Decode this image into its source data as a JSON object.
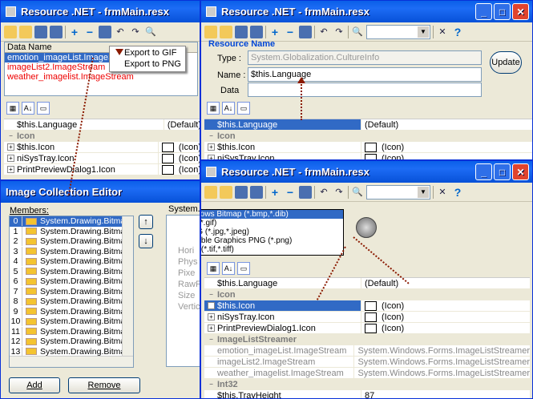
{
  "win1": {
    "title": "Resource .NET - frmMain.resx",
    "header": "Data Name",
    "items": [
      "emotion_imageList.ImageStream",
      "imageList2.ImageStream",
      "weather_imagelist.ImageStream"
    ],
    "menu": [
      "Export to GIF",
      "Export to PNG"
    ],
    "props": [
      {
        "n": "$this.Language",
        "v": "(Default)"
      },
      {
        "n": "Icon",
        "cat": true
      },
      {
        "n": "$this.Icon",
        "v": "(Icon)",
        "plus": true
      },
      {
        "n": "niSysTray.Icon",
        "v": "(Icon)",
        "plus": true
      },
      {
        "n": "PrintPreviewDialog1.Icon",
        "v": "(Icon)",
        "plus": true
      }
    ]
  },
  "editor": {
    "title": "Image Collection Editor",
    "members_label": "Members:",
    "prop_label": "System.D",
    "members": [
      "System.Drawing.Bitma",
      "System.Drawing.Bitma",
      "System.Drawing.Bitma",
      "System.Drawing.Bitma",
      "System.Drawing.Bitma",
      "System.Drawing.Bitma",
      "System.Drawing.Bitma",
      "System.Drawing.Bitma",
      "System.Drawing.Bitma",
      "System.Drawing.Bitma",
      "System.Drawing.Bitma",
      "System.Drawing.Bitma",
      "System.Drawing.Bitma",
      "System.Drawing.Bitma"
    ],
    "side_props": [
      "Hori",
      "Phys",
      "Pixe",
      "RawF",
      "Size",
      "Vertic"
    ],
    "add": "Add",
    "remove": "Remove"
  },
  "win2": {
    "title": "Resource .NET - frmMain.resx",
    "group": "Resource Name",
    "type_label": "Type :",
    "type_value": "System.Globalization.CultureInfo",
    "name_label": "Name :",
    "name_value": "$this.Language",
    "data_label": "Data",
    "update": "Update",
    "props": [
      {
        "n": "$this.Language",
        "v": "(Default)",
        "sel": true
      },
      {
        "n": "Icon",
        "cat": true
      },
      {
        "n": "$this.Icon",
        "v": "(Icon)",
        "plus": true
      },
      {
        "n": "niSysTray.Icon",
        "v": "(Icon)",
        "plus": true
      }
    ]
  },
  "win3": {
    "title": "Resource .NET - frmMain.resx",
    "formats": [
      "Windows Bitmap (*.bmp,*.dib)",
      "GIF (*.gif)",
      "JPEG (*.jpg,*.jpeg)",
      "Portable Graphics PNG (*.png)",
      "TIFF (*.tif,*.tiff)"
    ],
    "props": [
      {
        "n": "$this.Language",
        "v": "(Default)"
      },
      {
        "n": "Icon",
        "cat": true
      },
      {
        "n": "$this.Icon",
        "v": "(Icon)",
        "plus": true,
        "sel": true
      },
      {
        "n": "niSysTray.Icon",
        "v": "(Icon)",
        "plus": true
      },
      {
        "n": "PrintPreviewDialog1.Icon",
        "v": "(Icon)",
        "plus": true
      },
      {
        "n": "ImageListStreamer",
        "cat": true
      },
      {
        "n": "emotion_imageList.ImageStream",
        "v": "System.Windows.Forms.ImageListStreamer",
        "gray": true
      },
      {
        "n": "imageList2.ImageStream",
        "v": "System.Windows.Forms.ImageListStreamer",
        "gray": true
      },
      {
        "n": "weather_imagelist.ImageStream",
        "v": "System.Windows.Forms.ImageListStreamer",
        "gray": true
      },
      {
        "n": "Int32",
        "cat": true
      },
      {
        "n": "$this.TrayHeight",
        "v": "87"
      }
    ]
  }
}
